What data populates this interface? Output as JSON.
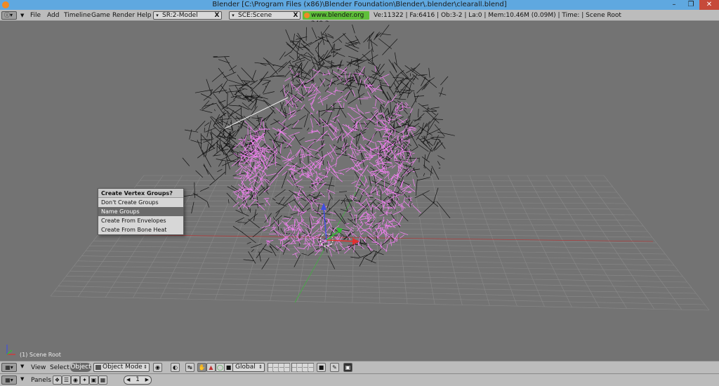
{
  "window": {
    "title": "Blender [C:\\Program Files (x86)\\Blender Foundation\\Blender\\.blender\\clearall.blend]",
    "minimize_glyph": "–",
    "maximize_glyph": "❐",
    "close_glyph": "✕"
  },
  "info_header": {
    "menus": [
      "File",
      "Add",
      "Timeline",
      "Game",
      "Render",
      "Help"
    ],
    "screen_field": "SR:2-Model",
    "scene_field": "SCE:Scene",
    "clear_glyph": "X",
    "website": "www.blender.org 249.2",
    "stats": "Ve:11322 | Fa:6416 | Ob:3-2 | La:0  | Mem:10.46M (0.09M)  | Time: | Scene Root"
  },
  "viewport": {
    "object_info": "(1) Scene Root",
    "colors": {
      "background": "#737373",
      "grid": "#8a8a8a",
      "wire_mesh": "#111111",
      "selected_armature": "#f080f0",
      "x_axis": "#b04040",
      "y_axis": "#40b040"
    }
  },
  "popup": {
    "title": "Create Vertex Groups?",
    "items": [
      "Don't Create Groups",
      "Name Groups",
      "Create From Envelopes",
      "Create From Bone Heat"
    ],
    "highlighted_index": 1
  },
  "view3d_header": {
    "view_label": "View",
    "select_label": "Select",
    "object_label": "Object",
    "mode": "Object Mode",
    "orientation": "Global"
  },
  "buttons_header": {
    "panels_label": "Panels",
    "frame_value": "1"
  }
}
